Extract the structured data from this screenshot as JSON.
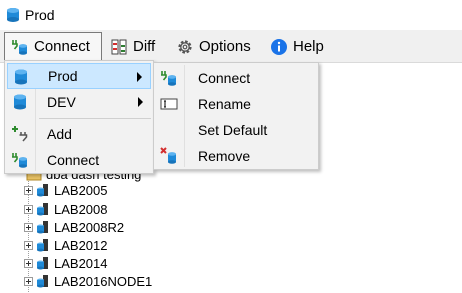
{
  "window": {
    "title": "Prod",
    "icon": "database-icon"
  },
  "menubar": {
    "items": [
      {
        "label": "Connect",
        "icon": "connect-plug-icon"
      },
      {
        "label": "Diff",
        "icon": "diff-icon"
      },
      {
        "label": "Options",
        "icon": "gear-icon"
      },
      {
        "label": "Help",
        "icon": "info-icon"
      }
    ]
  },
  "connect_menu": {
    "items": [
      {
        "label": "Prod",
        "icon": "database-icon",
        "has_submenu": true
      },
      {
        "label": "DEV",
        "icon": "database-icon",
        "has_submenu": true
      },
      {
        "label": "Add",
        "icon": "add-plug-icon"
      },
      {
        "label": "Connect",
        "icon": "connect-plug-icon"
      }
    ]
  },
  "prod_submenu": {
    "items": [
      {
        "label": "Connect",
        "icon": "connect-plug-icon"
      },
      {
        "label": "Rename",
        "icon": "rename-icon"
      },
      {
        "label": "Set Default",
        "icon": ""
      },
      {
        "label": "Remove",
        "icon": "remove-database-icon"
      }
    ]
  },
  "tree": {
    "partial_label": "dba dash testing",
    "items": [
      "LAB2005",
      "LAB2008",
      "LAB2008R2",
      "LAB2012",
      "LAB2014",
      "LAB2016NODE1"
    ]
  },
  "colors": {
    "highlight": "#cce8ff",
    "menu_bg": "#f2f2f2",
    "db_blue": "#1f8ad8",
    "info_blue": "#1a73e8"
  }
}
